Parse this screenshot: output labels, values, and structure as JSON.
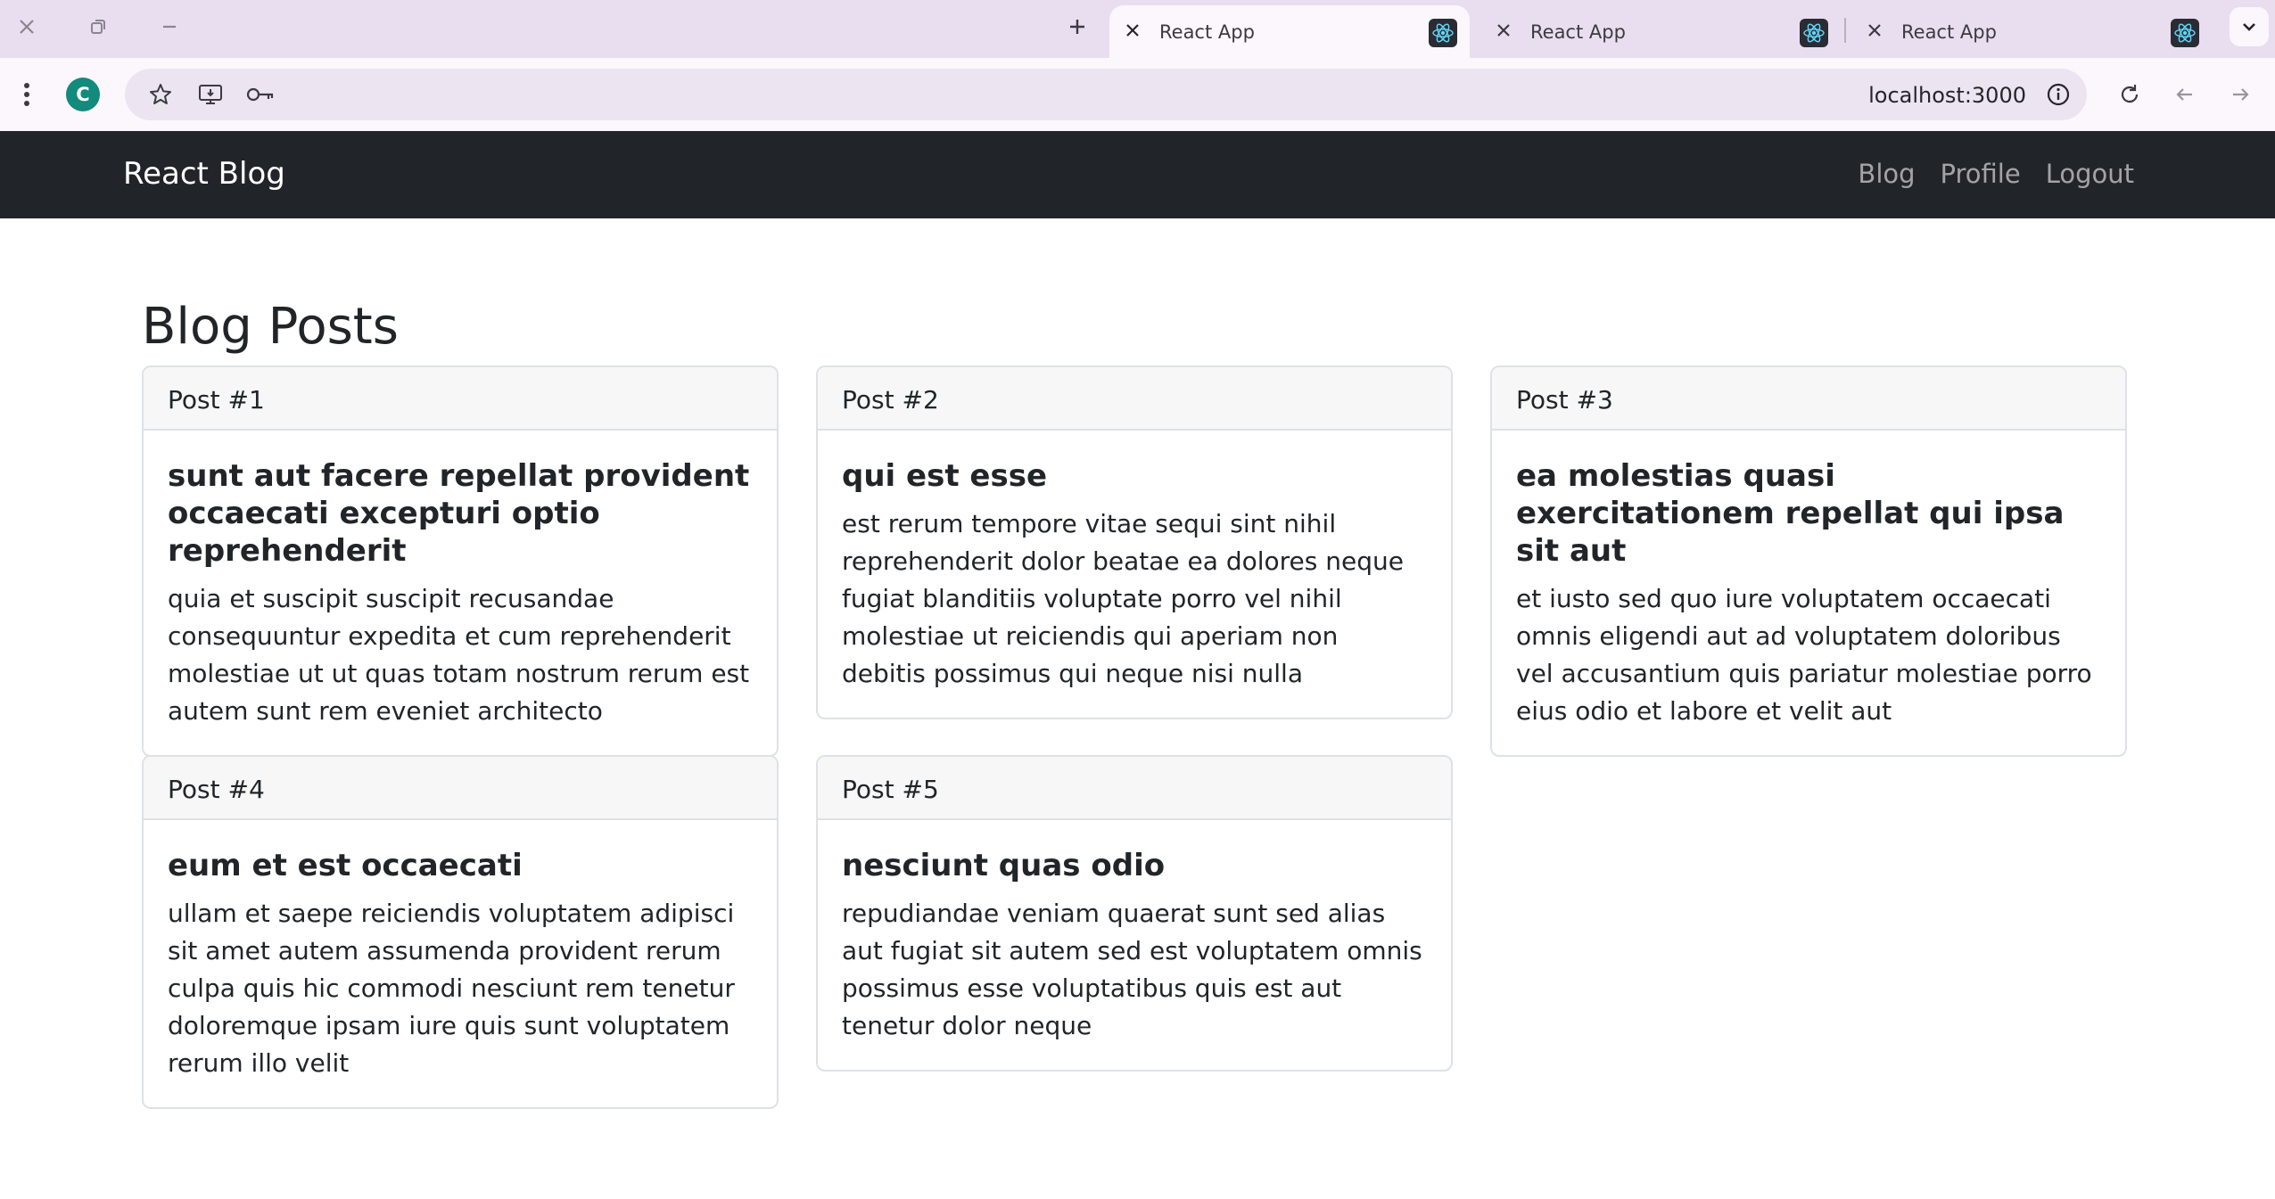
{
  "browser": {
    "tabs": [
      {
        "title": "React App",
        "active": true
      },
      {
        "title": "React App",
        "active": false
      },
      {
        "title": "React App",
        "active": false
      }
    ],
    "profile_initial": "C",
    "url": "localhost:3000"
  },
  "navbar": {
    "brand": "React Blog",
    "links": [
      "Blog",
      "Profile",
      "Logout"
    ]
  },
  "page": {
    "title": "Blog Posts"
  },
  "posts": [
    {
      "header": "Post #1",
      "title": "sunt aut facere repellat provident occaecati excepturi optio reprehenderit",
      "body": "quia et suscipit suscipit recusandae consequuntur expedita et cum reprehenderit molestiae ut ut quas totam nostrum rerum est autem sunt rem eveniet architecto"
    },
    {
      "header": "Post #2",
      "title": "qui est esse",
      "body": "est rerum tempore vitae sequi sint nihil reprehenderit dolor beatae ea dolores neque fugiat blanditiis voluptate porro vel nihil molestiae ut reiciendis qui aperiam non debitis possimus qui neque nisi nulla"
    },
    {
      "header": "Post #3",
      "title": "ea molestias quasi exercitationem repellat qui ipsa sit aut",
      "body": "et iusto sed quo iure voluptatem occaecati omnis eligendi aut ad voluptatem doloribus vel accusantium quis pariatur molestiae porro eius odio et labore et velit aut"
    },
    {
      "header": "Post #4",
      "title": "eum et est occaecati",
      "body": "ullam et saepe reiciendis voluptatem adipisci sit amet autem assumenda provident rerum culpa quis hic commodi nesciunt rem tenetur doloremque ipsam iure quis sunt voluptatem rerum illo velit"
    },
    {
      "header": "Post #5",
      "title": "nesciunt quas odio",
      "body": "repudiandae veniam quaerat sunt sed alias aut fugiat sit autem sed est voluptatem omnis possimus esse voluptatibus quis est aut tenetur dolor neque"
    }
  ]
}
